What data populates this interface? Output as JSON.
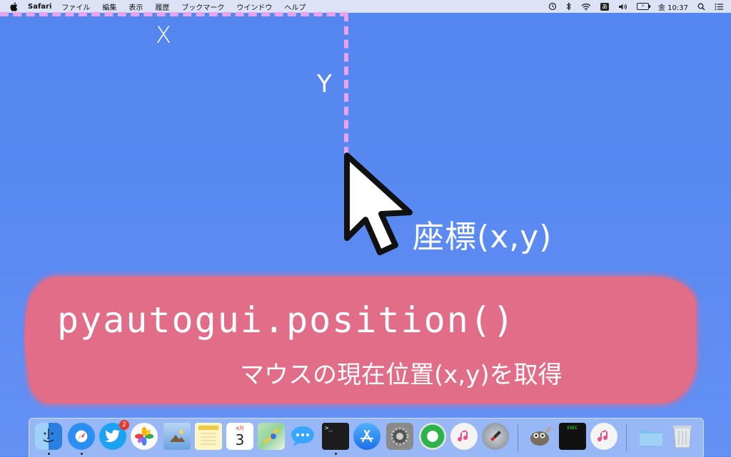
{
  "menubar": {
    "app_name": "Safari",
    "menus": [
      "ファイル",
      "編集",
      "表示",
      "履歴",
      "ブックマーク",
      "ウインドウ",
      "ヘルプ"
    ],
    "ime_label": "あ",
    "clock": "金 10:37"
  },
  "annotation": {
    "x_label": "X",
    "y_label": "Y",
    "coord_label": "座標(x,y)",
    "code": "pyautogui.position()",
    "description": "マウスの現在位置(x,y)を取得"
  },
  "dock": {
    "items": [
      {
        "name": "finder-icon",
        "color": "#3b8cf0",
        "running": true
      },
      {
        "name": "safari-icon",
        "color": "#2d8ef2",
        "running": true
      },
      {
        "name": "twitter-icon",
        "color": "#1da1f2",
        "badge": "2",
        "running": false
      },
      {
        "name": "photos-icon",
        "color": "#f5f5f5",
        "running": false
      },
      {
        "name": "preview-icon",
        "color": "#6aa3e0",
        "running": false
      },
      {
        "name": "notes-icon",
        "color": "#fff6c4",
        "running": false
      },
      {
        "name": "calendar-icon",
        "color": "#ffffff",
        "running": false
      },
      {
        "name": "maps-icon",
        "color": "#8fd39a",
        "running": false
      },
      {
        "name": "messages-icon",
        "color": "#38a5ff",
        "running": false
      },
      {
        "name": "terminal-icon",
        "color": "#1c1c1c",
        "running": true
      },
      {
        "name": "app-store-icon",
        "color": "#2c8cf4",
        "running": false
      },
      {
        "name": "system-preferences-icon",
        "color": "#8a8a8a",
        "running": false
      },
      {
        "name": "find-my-icon",
        "color": "#2fb24c",
        "running": false
      },
      {
        "name": "itunes-icon",
        "color": "#f4f4f4",
        "running": false
      },
      {
        "name": "launchpad-icon",
        "color": "#9aa0a8",
        "running": false
      },
      {
        "name": "gimp-icon",
        "color": "#7a6d5c",
        "running": false
      },
      {
        "name": "exec-terminal-icon",
        "color": "#111111",
        "running": false
      },
      {
        "name": "music-icon",
        "color": "#f4f4f4",
        "running": false
      },
      {
        "name": "downloads-folder-icon",
        "color": "#7fbfee",
        "running": false
      },
      {
        "name": "trash-icon",
        "color": "#d9dde2",
        "running": false
      }
    ],
    "calendar_month": "4月",
    "calendar_day": "3",
    "exec_label": "EXEC"
  }
}
